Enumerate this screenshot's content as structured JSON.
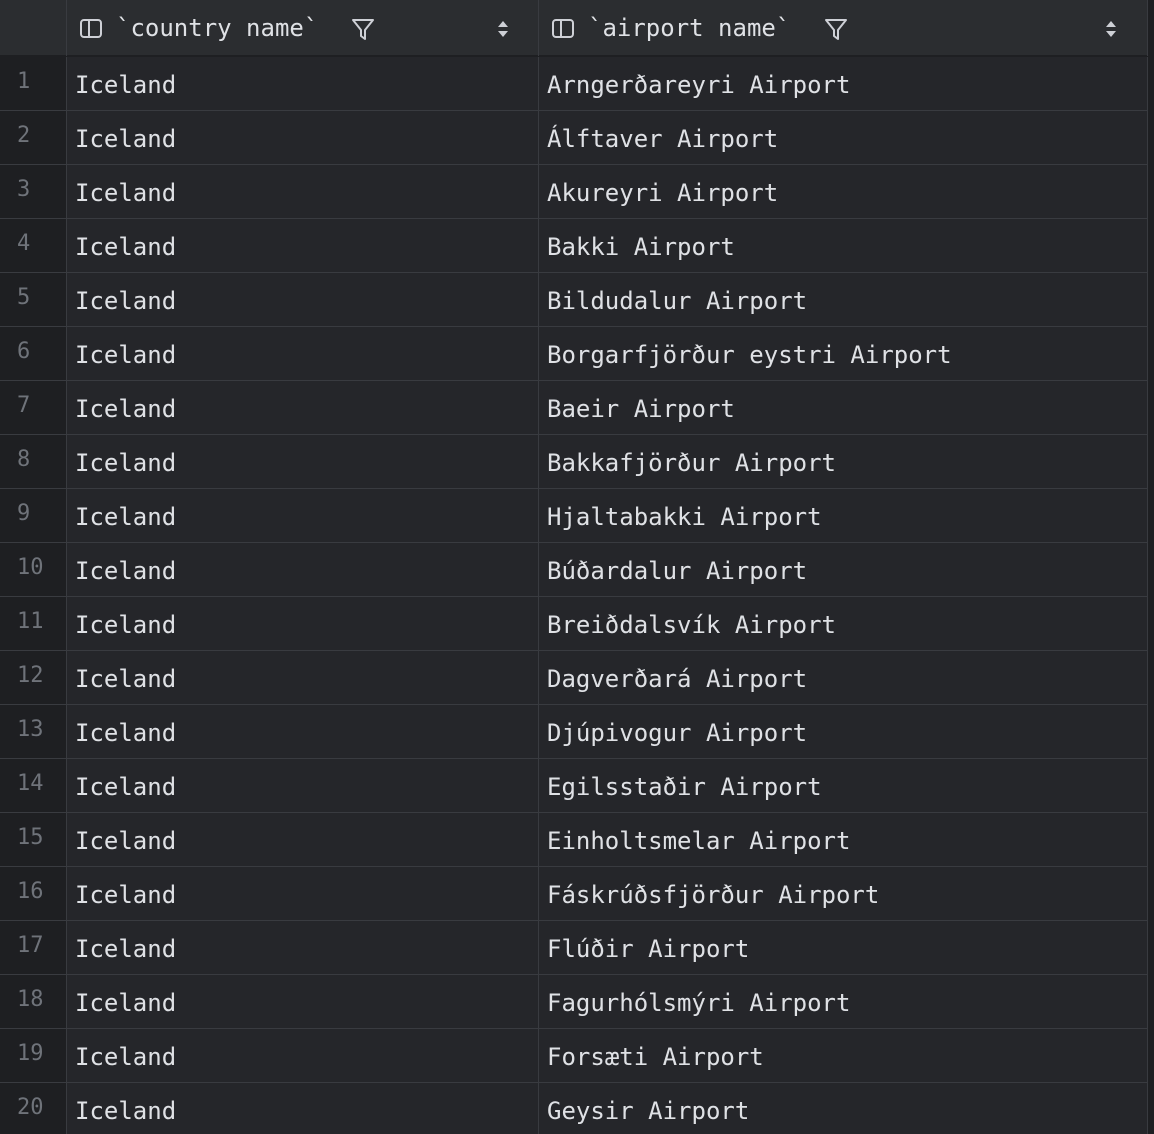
{
  "columns": [
    {
      "name": "`country name`",
      "icon": "column-icon",
      "filter_icon": "filter-icon",
      "sort_icon": "sort-icon"
    },
    {
      "name": "`airport name`",
      "icon": "column-icon",
      "filter_icon": "filter-icon",
      "sort_icon": "sort-icon"
    }
  ],
  "rows": [
    {
      "n": "1",
      "country": "Iceland",
      "airport": "Arngerðareyri Airport"
    },
    {
      "n": "2",
      "country": "Iceland",
      "airport": "Álftaver Airport"
    },
    {
      "n": "3",
      "country": "Iceland",
      "airport": "Akureyri Airport"
    },
    {
      "n": "4",
      "country": "Iceland",
      "airport": "Bakki Airport"
    },
    {
      "n": "5",
      "country": "Iceland",
      "airport": "Bildudalur Airport"
    },
    {
      "n": "6",
      "country": "Iceland",
      "airport": "Borgarfjörður eystri Airport"
    },
    {
      "n": "7",
      "country": "Iceland",
      "airport": "Baeir Airport"
    },
    {
      "n": "8",
      "country": "Iceland",
      "airport": "Bakkafjörður Airport"
    },
    {
      "n": "9",
      "country": "Iceland",
      "airport": "Hjaltabakki Airport"
    },
    {
      "n": "10",
      "country": "Iceland",
      "airport": "Búðardalur Airport"
    },
    {
      "n": "11",
      "country": "Iceland",
      "airport": "Breiðdalsvík Airport"
    },
    {
      "n": "12",
      "country": "Iceland",
      "airport": "Dagverðará Airport"
    },
    {
      "n": "13",
      "country": "Iceland",
      "airport": "Djúpivogur Airport"
    },
    {
      "n": "14",
      "country": "Iceland",
      "airport": "Egilsstaðir Airport"
    },
    {
      "n": "15",
      "country": "Iceland",
      "airport": "Einholtsmelar Airport"
    },
    {
      "n": "16",
      "country": "Iceland",
      "airport": "Fáskrúðsfjörður Airport"
    },
    {
      "n": "17",
      "country": "Iceland",
      "airport": "Flúðir Airport"
    },
    {
      "n": "18",
      "country": "Iceland",
      "airport": "Fagurhólsmýri Airport"
    },
    {
      "n": "19",
      "country": "Iceland",
      "airport": "Forsæti Airport"
    },
    {
      "n": "20",
      "country": "Iceland",
      "airport": "Geysir Airport"
    }
  ],
  "colors": {
    "background": "#1e1f22",
    "header": "#2b2d30",
    "cell": "#25262a",
    "grid_line": "#393b40",
    "text": "#dfe1e5",
    "row_number": "#6f737a"
  }
}
